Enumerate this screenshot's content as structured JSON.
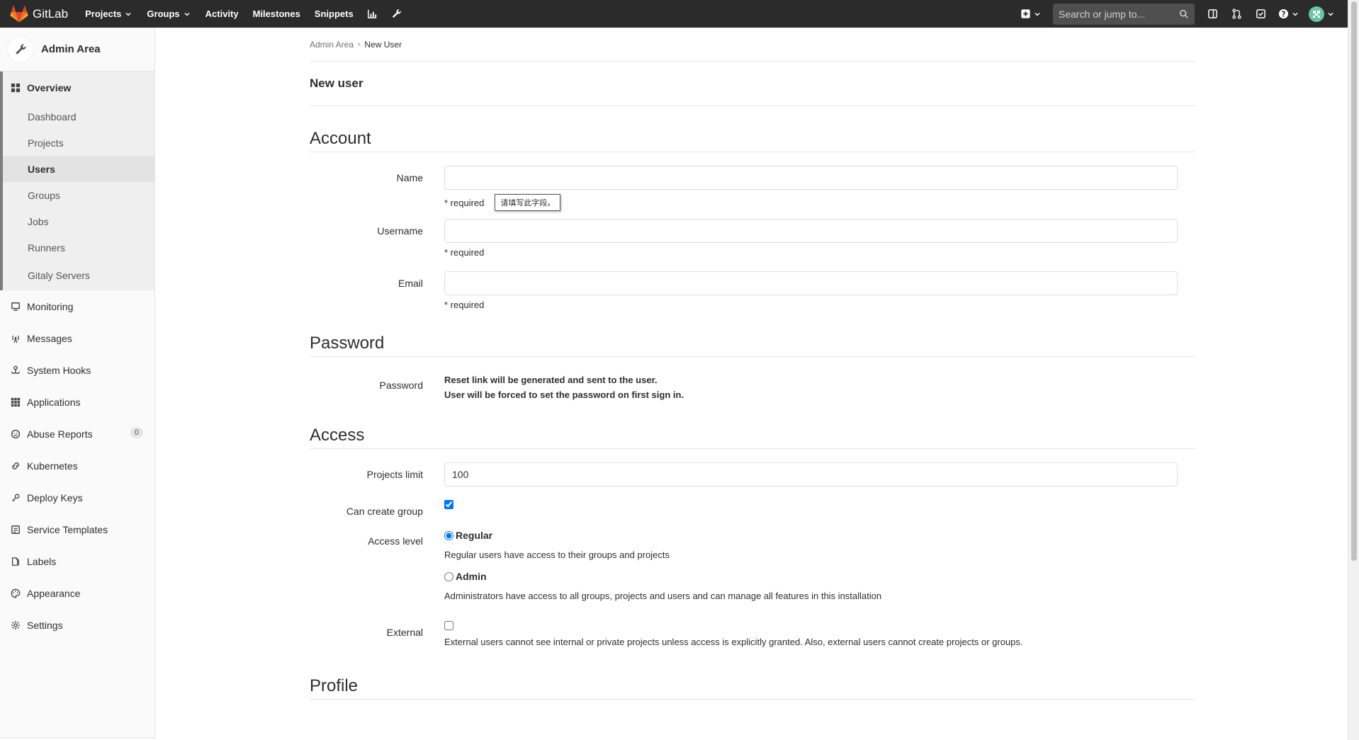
{
  "navbar": {
    "brand": "GitLab",
    "links": [
      {
        "label": "Projects",
        "dropdown": true
      },
      {
        "label": "Groups",
        "dropdown": true
      },
      {
        "label": "Activity",
        "dropdown": false
      },
      {
        "label": "Milestones",
        "dropdown": false
      },
      {
        "label": "Snippets",
        "dropdown": false
      }
    ],
    "search_placeholder": "Search or jump to...",
    "bg_color": "#2b2b2b"
  },
  "sidebar": {
    "title": "Admin Area",
    "overview": {
      "label": "Overview",
      "items": [
        "Dashboard",
        "Projects",
        "Users",
        "Groups",
        "Jobs",
        "Runners",
        "Gitaly Servers"
      ],
      "active": "Users"
    },
    "items": [
      {
        "label": "Monitoring",
        "icon": "monitor-icon"
      },
      {
        "label": "Messages",
        "icon": "broadcast-icon"
      },
      {
        "label": "System Hooks",
        "icon": "hook-icon"
      },
      {
        "label": "Applications",
        "icon": "applications-icon"
      },
      {
        "label": "Abuse Reports",
        "icon": "abuse-icon",
        "badge": "0"
      },
      {
        "label": "Kubernetes",
        "icon": "kubernetes-icon"
      },
      {
        "label": "Deploy Keys",
        "icon": "key-icon"
      },
      {
        "label": "Service Templates",
        "icon": "template-icon"
      },
      {
        "label": "Labels",
        "icon": "labels-icon"
      },
      {
        "label": "Appearance",
        "icon": "appearance-icon"
      },
      {
        "label": "Settings",
        "icon": "settings-icon"
      }
    ]
  },
  "breadcrumb": {
    "parent": "Admin Area",
    "current": "New User"
  },
  "page_title": "New user",
  "account": {
    "legend": "Account",
    "name_label": "Name",
    "username_label": "Username",
    "email_label": "Email",
    "required_text": "* required",
    "validation_tooltip": "请填写此字段。"
  },
  "password": {
    "legend": "Password",
    "label": "Password",
    "line1": "Reset link will be generated and sent to the user.",
    "line2": "User will be forced to set the password on first sign in."
  },
  "access": {
    "legend": "Access",
    "projects_limit_label": "Projects limit",
    "projects_limit_value": "100",
    "can_create_group_label": "Can create group",
    "can_create_group_checked": true,
    "access_level_label": "Access level",
    "regular_label": "Regular",
    "regular_help": "Regular users have access to their groups and projects",
    "admin_label": "Admin",
    "admin_help": "Administrators have access to all groups, projects and users and can manage all features in this installation",
    "selected_level": "Regular",
    "external_label": "External",
    "external_help": "External users cannot see internal or private projects unless access is explicitly granted. Also, external users cannot create projects or groups.",
    "external_checked": false
  },
  "profile": {
    "legend": "Profile"
  }
}
